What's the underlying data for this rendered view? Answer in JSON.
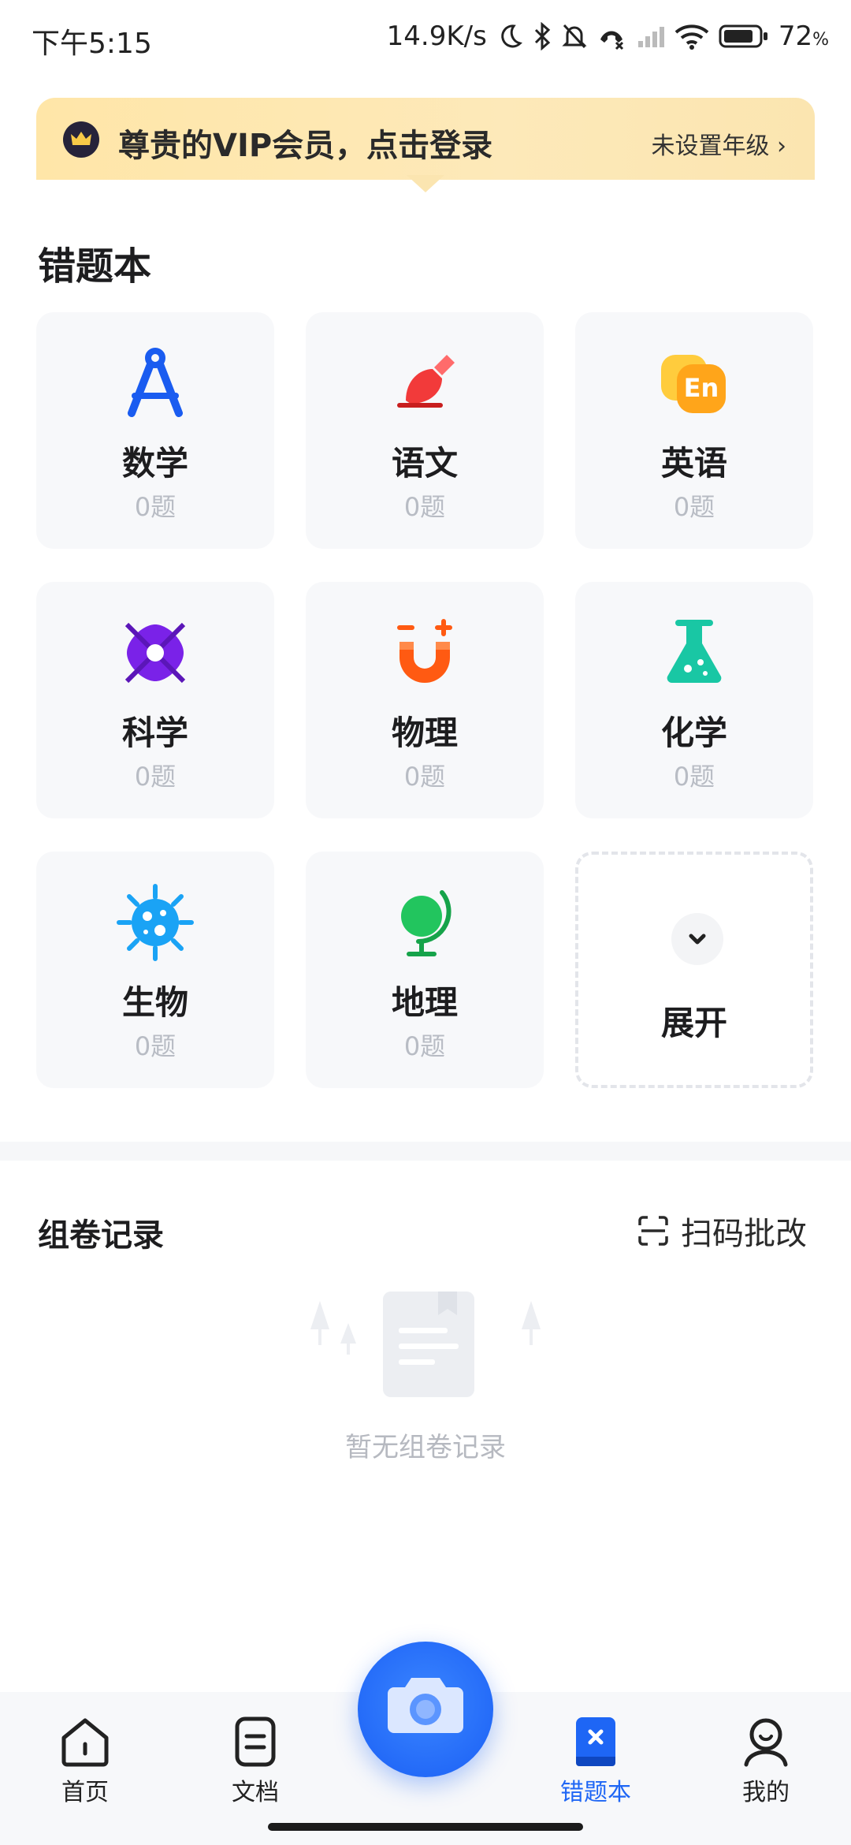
{
  "status_bar": {
    "time": "下午5:15",
    "net_speed": "14.9K/s",
    "battery": "72",
    "battery_unit": "%"
  },
  "vip_banner": {
    "title": "尊贵的VIP会员，点击登录",
    "grade": "未设置年级 ›"
  },
  "mistakes": {
    "title": "错题本",
    "subjects": [
      {
        "name": "数学",
        "count": "0题",
        "icon": "compass-icon",
        "color": "#1a5cf0"
      },
      {
        "name": "语文",
        "count": "0题",
        "icon": "brush-icon",
        "color": "#f23a3a"
      },
      {
        "name": "英语",
        "count": "0题",
        "icon": "en-bubble-icon",
        "color": "#ffb21a"
      },
      {
        "name": "科学",
        "count": "0题",
        "icon": "atom-icon",
        "color": "#7a22e8"
      },
      {
        "name": "物理",
        "count": "0题",
        "icon": "magnet-icon",
        "color": "#ff5a12"
      },
      {
        "name": "化学",
        "count": "0题",
        "icon": "flask-icon",
        "color": "#19c7a4"
      },
      {
        "name": "生物",
        "count": "0题",
        "icon": "virus-icon",
        "color": "#1aa3f5"
      },
      {
        "name": "地理",
        "count": "0题",
        "icon": "globe-icon",
        "color": "#22c55e"
      }
    ],
    "expand_label": "展开"
  },
  "records": {
    "title": "组卷记录",
    "scan_label": "扫码批改",
    "empty_text": "暂无组卷记录"
  },
  "tabbar": {
    "home": "首页",
    "docs": "文档",
    "mistakes": "错题本",
    "mine": "我的"
  },
  "colors": {
    "accent": "#1e66f5",
    "vip_bg": "#fde9b9"
  }
}
